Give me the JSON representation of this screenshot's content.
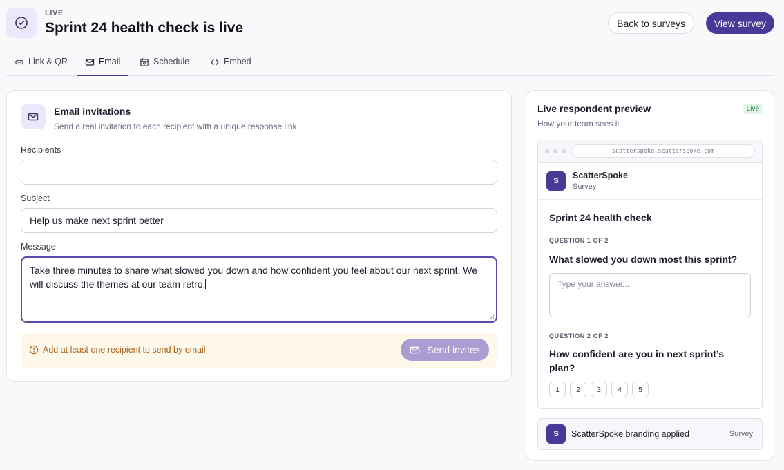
{
  "header": {
    "eyebrow": "LIVE",
    "title": "Sprint 24 health check is live",
    "back_label": "Back to surveys",
    "view_label": "View survey"
  },
  "tabs": [
    {
      "label": "Link & QR",
      "icon": "link-icon"
    },
    {
      "label": "Email",
      "icon": "mail-icon"
    },
    {
      "label": "Schedule",
      "icon": "calendar-icon"
    },
    {
      "label": "Embed",
      "icon": "code-icon"
    }
  ],
  "active_tab": "Email",
  "email": {
    "title": "Email invitations",
    "subtitle": "Send a real invitation to each recipient with a unique response link.",
    "recipients_label": "Recipients",
    "recipients_value": "",
    "subject_label": "Subject",
    "subject_value": "Help us make next sprint better",
    "message_label": "Message",
    "message_value": "Take three minutes to share what slowed you down and how confident you feel about our next sprint. We will discuss the themes at our team retro.",
    "warning": "Add at least one recipient to send by email",
    "send_label": "Send invites"
  },
  "preview": {
    "title": "Live respondent preview",
    "subtitle": "How your team sees it",
    "badge": "Live",
    "url": "scatterspoke.scatterspoke.com",
    "brand_initial": "S",
    "brand_name": "ScatterSpoke",
    "brand_kind": "Survey",
    "survey_title": "Sprint 24 health check",
    "q1_label": "QUESTION 1 OF 2",
    "q1_text": "What slowed you down most this sprint?",
    "q1_placeholder": "Type your answer...",
    "q2_label": "QUESTION 2 OF 2",
    "q2_text": "How confident are you in next sprint’s plan?",
    "scale": [
      "1",
      "2",
      "3",
      "4",
      "5"
    ],
    "branding_text": "ScatterSpoke branding applied",
    "branding_kind": "Survey"
  },
  "colors": {
    "accent": "#4a3a98",
    "accent_soft": "#ece8fb",
    "warning_bg": "#fdf8ea",
    "warning_text": "#a8621b",
    "live_green": "#1f8a4c"
  }
}
